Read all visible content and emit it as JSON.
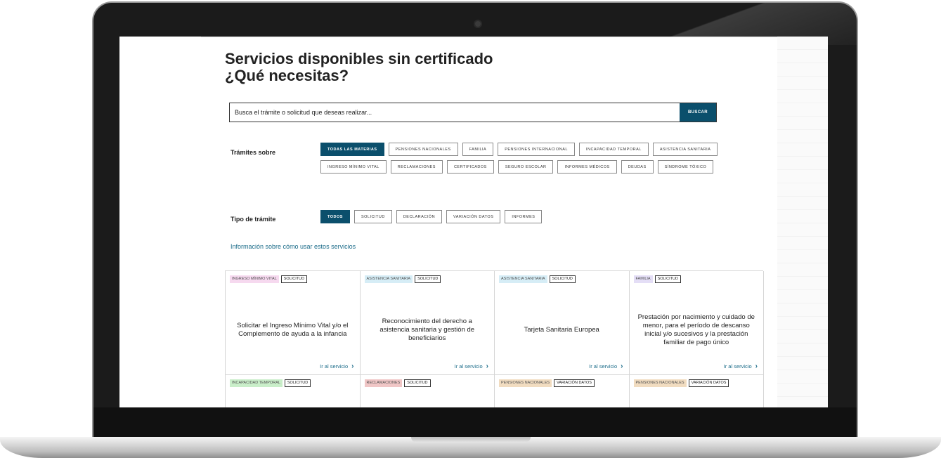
{
  "page": {
    "title_line1": "Servicios disponibles sin certificado",
    "title_line2": "¿Qué necesitas?"
  },
  "search": {
    "placeholder": "Busca el trámite o solicitud que deseas realizar...",
    "button": "BUSCAR"
  },
  "filters": {
    "subject_label": "Trámites sobre",
    "subjects": [
      {
        "label": "TODAS LAS MATERIAS",
        "active": true
      },
      {
        "label": "PENSIONES NACIONALES",
        "active": false
      },
      {
        "label": "FAMILIA",
        "active": false
      },
      {
        "label": "PENSIONES INTERNACIONAL",
        "active": false
      },
      {
        "label": "INCAPACIDAD TEMPORAL",
        "active": false
      },
      {
        "label": "ASISTENCIA SANITARIA",
        "active": false
      },
      {
        "label": "INGRESO MÍNIMO VITAL",
        "active": false
      },
      {
        "label": "RECLAMACIONES",
        "active": false
      },
      {
        "label": "CERTIFICADOS",
        "active": false
      },
      {
        "label": "SEGURO ESCOLAR",
        "active": false
      },
      {
        "label": "INFORMES MÉDICOS",
        "active": false
      },
      {
        "label": "DEUDAS",
        "active": false
      },
      {
        "label": "SÍNDROME TÓXICO",
        "active": false
      }
    ],
    "type_label": "Tipo de trámite",
    "types": [
      {
        "label": "TODOS",
        "active": true
      },
      {
        "label": "SOLICITUD",
        "active": false
      },
      {
        "label": "DECLARACIÓN",
        "active": false
      },
      {
        "label": "VARIACIÓN DATOS",
        "active": false
      },
      {
        "label": "INFORMES",
        "active": false
      }
    ]
  },
  "info_link": "Información sobre cómo usar estos servicios",
  "colors": {
    "primary": "#0b4f6c",
    "link": "#1d6d8a",
    "tag_imv": "#f6d9ef",
    "tag_sanitaria": "#d6edf6",
    "tag_familia": "#e4def6",
    "tag_it": "#c9eec9",
    "tag_reclamaciones": "#f0c6c6",
    "tag_pensiones": "#f1dcc0"
  },
  "cards": [
    {
      "tag": "INGRESO MÍNIMO VITAL",
      "tag_color": "#f6d9ef",
      "type": "SOLICITUD",
      "title": "Solicitar el Ingreso Mínimo Vital y/o el Complemento de ayuda a la infancia",
      "link": "Ir al servicio"
    },
    {
      "tag": "ASISTENCIA SANITARIA",
      "tag_color": "#d6edf6",
      "type": "SOLICITUD",
      "title": "Reconocimiento del derecho a asistencia sanitaria y gestión de beneficiarios",
      "link": "Ir al servicio"
    },
    {
      "tag": "ASISTENCIA SANITARIA",
      "tag_color": "#d6edf6",
      "type": "SOLICITUD",
      "title": "Tarjeta Sanitaria Europea",
      "link": "Ir al servicio"
    },
    {
      "tag": "FAMILIA",
      "tag_color": "#e4def6",
      "type": "SOLICITUD",
      "title": "Prestación por nacimiento y cuidado de menor, para el período de descanso inicial y/o sucesivos y la prestación familiar de pago único",
      "link": "Ir al servicio"
    },
    {
      "tag": "INCAPACIDAD TEMPORAL",
      "tag_color": "#c9eec9",
      "type": "SOLICITUD",
      "title": "",
      "link": ""
    },
    {
      "tag": "RECLAMACIONES",
      "tag_color": "#f0c6c6",
      "type": "SOLICITUD",
      "title": "",
      "link": ""
    },
    {
      "tag": "PENSIONES NACIONALES",
      "tag_color": "#f1dcc0",
      "type": "VARIACIÓN DATOS",
      "title": "",
      "link": ""
    },
    {
      "tag": "PENSIONES NACIONALES",
      "tag_color": "#f1dcc0",
      "type": "VARIACIÓN DATOS",
      "title": "",
      "link": ""
    }
  ]
}
